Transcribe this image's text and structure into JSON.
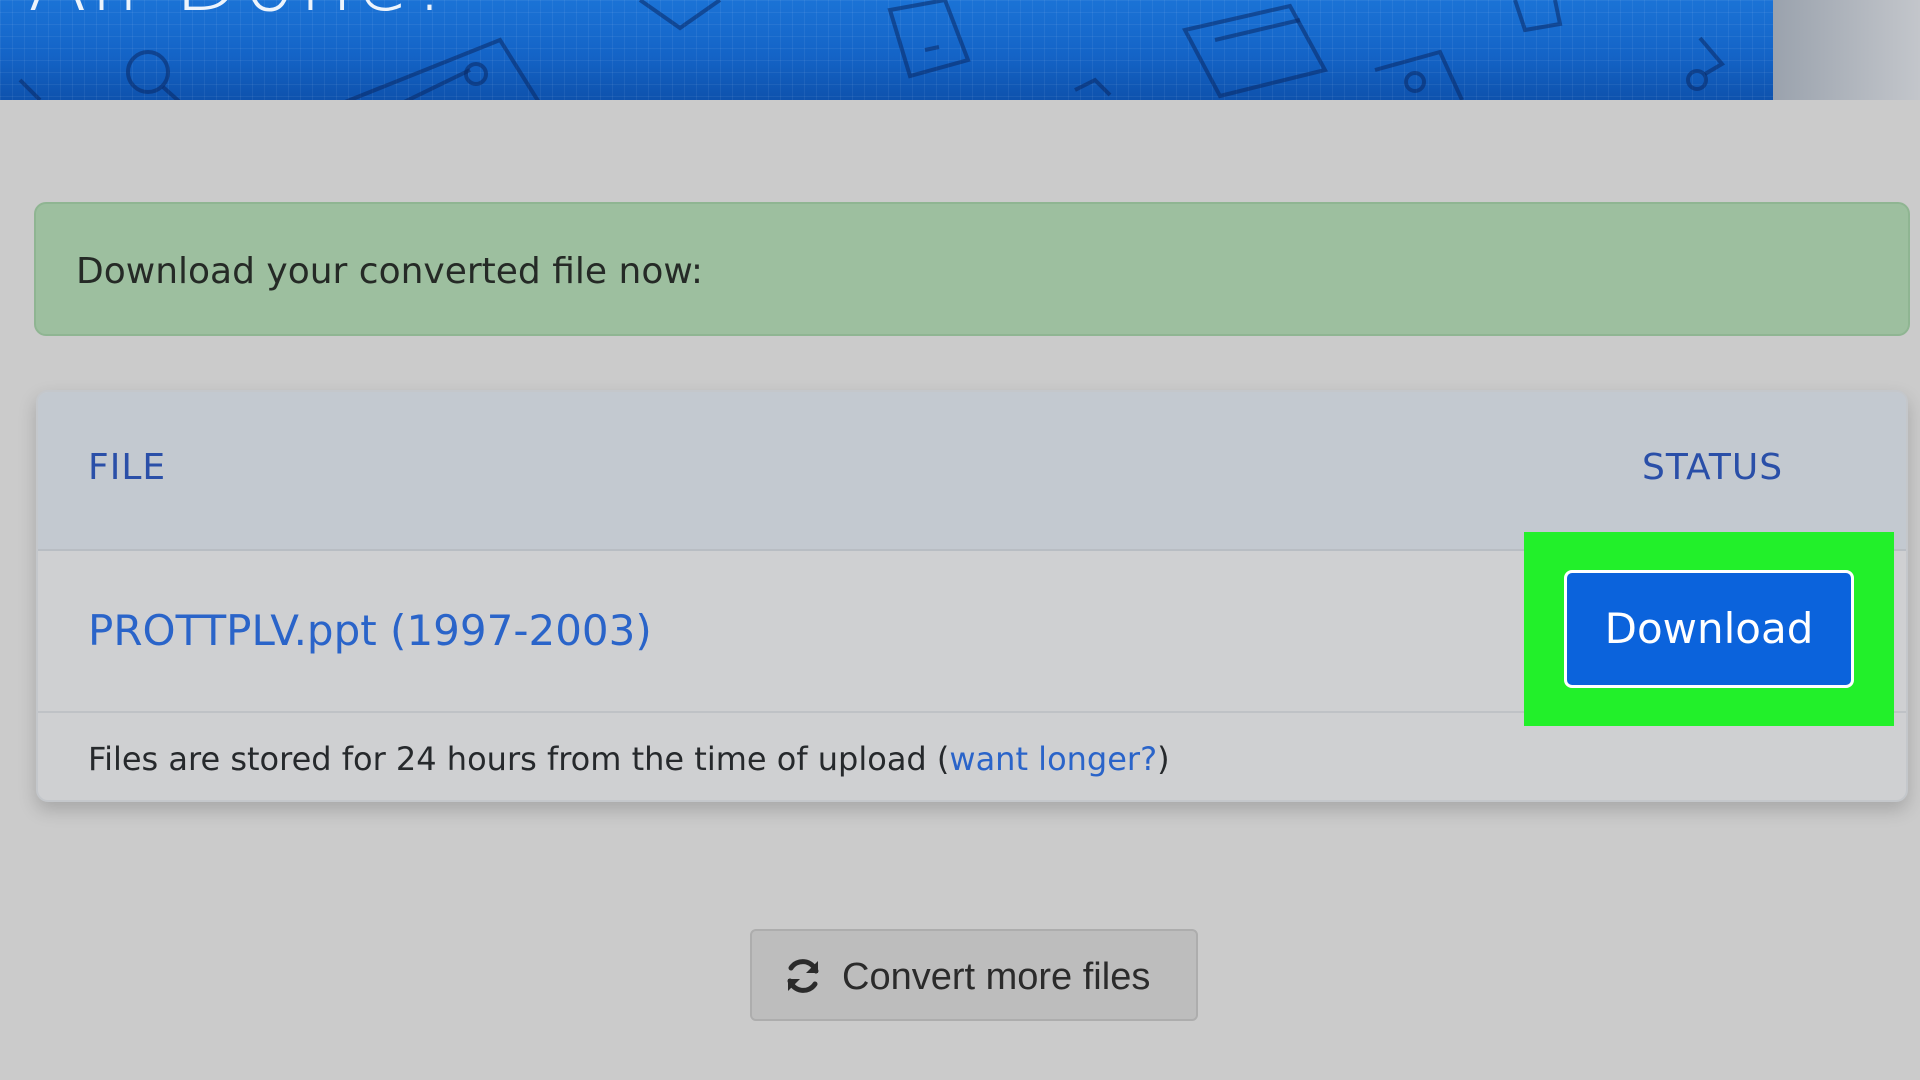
{
  "banner": {
    "title": "All Done!"
  },
  "alert": {
    "message": "Download your converted file now:"
  },
  "table": {
    "columns": [
      "FILE",
      "STATUS"
    ],
    "rows": [
      {
        "file_name": "PROTTPLV.ppt (1997-2003)",
        "status_action": "Download"
      }
    ],
    "footer_note_prefix": "Files are stored for 24 hours from the time of upload (",
    "footer_link": "want longer?",
    "footer_note_suffix": ")"
  },
  "actions": {
    "convert_more_label": "Convert more files",
    "convert_more_icon": "refresh-icon"
  },
  "colors": {
    "banner_blue": "#1464c7",
    "alert_green": "#9dbf9f",
    "link_blue": "#2a64c9",
    "download_button_blue": "#0b63dc",
    "highlight_green": "#22f02a"
  }
}
